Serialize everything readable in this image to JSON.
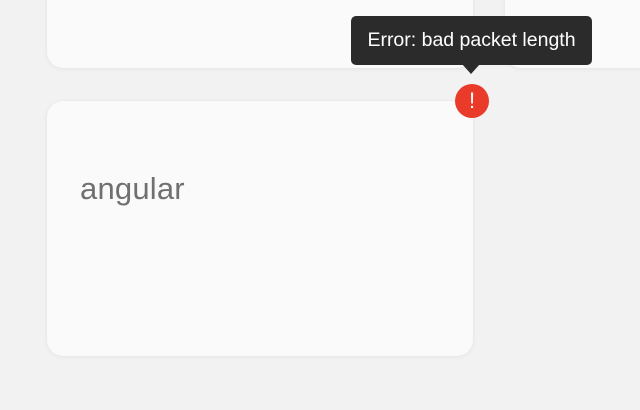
{
  "tooltip": {
    "text": "Error: bad packet length"
  },
  "error_badge": {
    "icon": "exclamation-icon",
    "glyph": "!",
    "color": "#ea3a2a"
  },
  "cards": [
    {
      "label": ""
    },
    {
      "label": ""
    },
    {
      "label": "angular"
    }
  ],
  "colors": {
    "background": "#f2f2f2",
    "card": "#fafafa",
    "tooltip_bg": "#2b2b2b",
    "label_text": "#707070"
  }
}
